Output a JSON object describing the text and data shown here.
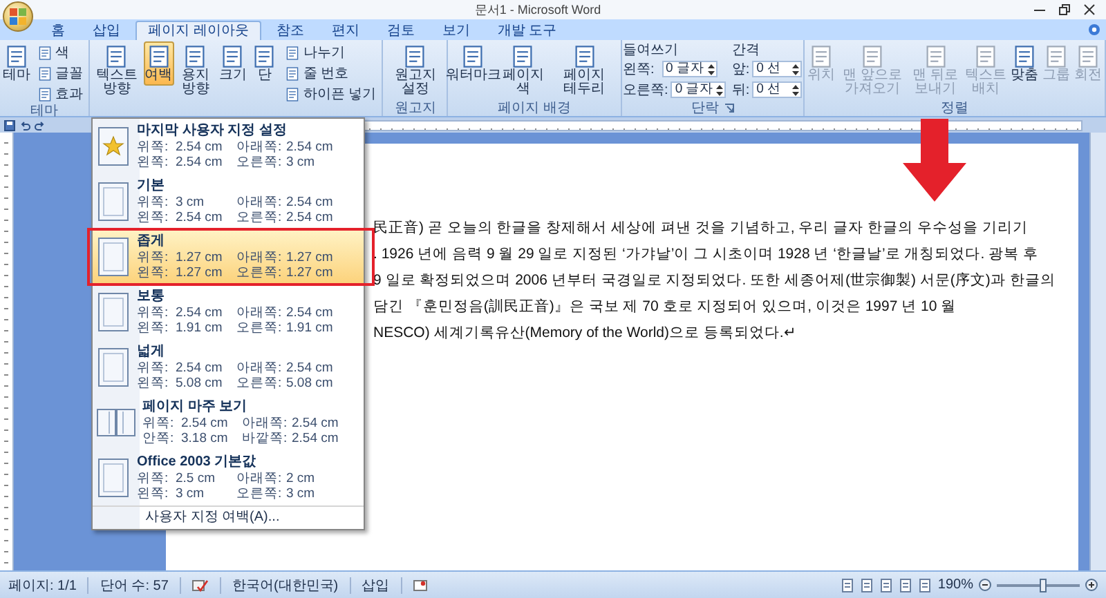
{
  "window": {
    "title": "문서1 - Microsoft Word"
  },
  "tabs": [
    {
      "label": "홈",
      "selected": false
    },
    {
      "label": "삽입",
      "selected": false
    },
    {
      "label": "페이지 레이아웃",
      "selected": true
    },
    {
      "label": "참조",
      "selected": false
    },
    {
      "label": "편지",
      "selected": false
    },
    {
      "label": "검토",
      "selected": false
    },
    {
      "label": "보기",
      "selected": false
    },
    {
      "label": "개발 도구",
      "selected": false
    }
  ],
  "ribbon": {
    "groups": [
      {
        "kind": "buttons",
        "label": "테마",
        "buttons": [
          {
            "label": "테마",
            "kind": "large",
            "pressed": false,
            "disabled": false
          },
          {
            "label": "색",
            "kind": "small",
            "pressed": false,
            "disabled": false
          },
          {
            "label": "글꼴",
            "kind": "small",
            "pressed": false,
            "disabled": false
          },
          {
            "label": "효과",
            "kind": "small",
            "pressed": false,
            "disabled": false
          }
        ]
      },
      {
        "kind": "buttons",
        "buttons": [
          {
            "label": "텍스트 방향",
            "kind": "large",
            "pressed": false,
            "disabled": false
          },
          {
            "label": "여백",
            "kind": "large",
            "pressed": true,
            "disabled": false
          },
          {
            "label": "용지 방향",
            "kind": "large",
            "pressed": false,
            "disabled": false
          },
          {
            "label": "크기",
            "kind": "large",
            "pressed": false,
            "disabled": false
          },
          {
            "label": "단",
            "kind": "large",
            "pressed": false,
            "disabled": false
          },
          {
            "label": "나누기",
            "kind": "small",
            "pressed": false,
            "disabled": false
          },
          {
            "label": "줄 번호",
            "kind": "small",
            "pressed": false,
            "disabled": false
          },
          {
            "label": "하이픈 넣기",
            "kind": "small",
            "pressed": false,
            "disabled": false
          }
        ]
      },
      {
        "kind": "buttons",
        "label": "원고지",
        "buttons": [
          {
            "label": "원고지 설정",
            "kind": "large",
            "pressed": false,
            "disabled": false
          }
        ]
      },
      {
        "kind": "buttons",
        "label": "페이지 배경",
        "buttons": [
          {
            "label": "워터마크",
            "kind": "large",
            "pressed": false,
            "disabled": false
          },
          {
            "label": "페이지 색",
            "kind": "large",
            "pressed": false,
            "disabled": false
          },
          {
            "label": "페이지 테두리",
            "kind": "large",
            "pressed": false,
            "disabled": false
          }
        ]
      },
      {
        "kind": "fields",
        "label": "단락",
        "sections": [
          {
            "title": "들여쓰기",
            "fields": [
              {
                "label": "왼쪽:",
                "value": "0 글자"
              },
              {
                "label": "오른쪽:",
                "value": "0 글자"
              }
            ]
          },
          {
            "title": "간격",
            "fields": [
              {
                "label": "앞:",
                "value": "0 선"
              },
              {
                "label": "뒤:",
                "value": "0 선"
              }
            ]
          }
        ]
      },
      {
        "kind": "buttons",
        "label": "정렬",
        "buttons": [
          {
            "label": "위치",
            "kind": "large",
            "pressed": false,
            "disabled": true
          },
          {
            "label": "맨 앞으로 가져오기",
            "kind": "large",
            "pressed": false,
            "disabled": true
          },
          {
            "label": "맨 뒤로 보내기",
            "kind": "large",
            "pressed": false,
            "disabled": true
          },
          {
            "label": "텍스트 배치",
            "kind": "large",
            "pressed": false,
            "disabled": true
          },
          {
            "label": "맞춤",
            "kind": "large",
            "pressed": false,
            "disabled": false
          },
          {
            "label": "그룹",
            "kind": "large",
            "pressed": false,
            "disabled": true
          },
          {
            "label": "회전",
            "kind": "large",
            "pressed": false,
            "disabled": true
          }
        ]
      }
    ]
  },
  "margin_menu": {
    "items": [
      {
        "title": "마지막 사용자 지정 설정",
        "kind": "custom",
        "selected": false,
        "fields": [
          {
            "label": "위쪽:",
            "value": "2.54 cm"
          },
          {
            "label": "아래쪽:",
            "value": "2.54 cm"
          },
          {
            "label": "왼쪽:",
            "value": "2.54 cm"
          },
          {
            "label": "오른쪽:",
            "value": "3 cm"
          }
        ]
      },
      {
        "title": "기본",
        "kind": "page",
        "selected": false,
        "fields": [
          {
            "label": "위쪽:",
            "value": "3 cm"
          },
          {
            "label": "아래쪽:",
            "value": "2.54 cm"
          },
          {
            "label": "왼쪽:",
            "value": "2.54 cm"
          },
          {
            "label": "오른쪽:",
            "value": "2.54 cm"
          }
        ]
      },
      {
        "title": "좁게",
        "kind": "page",
        "selected": true,
        "fields": [
          {
            "label": "위쪽:",
            "value": "1.27 cm"
          },
          {
            "label": "아래쪽:",
            "value": "1.27 cm"
          },
          {
            "label": "왼쪽:",
            "value": "1.27 cm"
          },
          {
            "label": "오른쪽:",
            "value": "1.27 cm"
          }
        ]
      },
      {
        "title": "보통",
        "kind": "page",
        "selected": false,
        "fields": [
          {
            "label": "위쪽:",
            "value": "2.54 cm"
          },
          {
            "label": "아래쪽:",
            "value": "2.54 cm"
          },
          {
            "label": "왼쪽:",
            "value": "1.91 cm"
          },
          {
            "label": "오른쪽:",
            "value": "1.91 cm"
          }
        ]
      },
      {
        "title": "넓게",
        "kind": "page",
        "selected": false,
        "fields": [
          {
            "label": "위쪽:",
            "value": "2.54 cm"
          },
          {
            "label": "아래쪽:",
            "value": "2.54 cm"
          },
          {
            "label": "왼쪽:",
            "value": "5.08 cm"
          },
          {
            "label": "오른쪽:",
            "value": "5.08 cm"
          }
        ]
      },
      {
        "title": "페이지 마주 보기",
        "kind": "mirrored",
        "selected": false,
        "fields": [
          {
            "label": "위쪽:",
            "value": "2.54 cm"
          },
          {
            "label": "아래쪽:",
            "value": "2.54 cm"
          },
          {
            "label": "안쪽:",
            "value": "3.18 cm"
          },
          {
            "label": "바깥쪽:",
            "value": "2.54 cm"
          }
        ]
      },
      {
        "title": "Office 2003 기본값",
        "kind": "page",
        "selected": false,
        "fields": [
          {
            "label": "위쪽:",
            "value": "2.5 cm"
          },
          {
            "label": "아래쪽:",
            "value": "2 cm"
          },
          {
            "label": "왼쪽:",
            "value": "3 cm"
          },
          {
            "label": "오른쪽:",
            "value": "3 cm"
          }
        ]
      }
    ],
    "footer": "사용자 지정 여백(A)..."
  },
  "document": {
    "lines": [
      "民正音) 곧 오늘의 한글을 창제해서 세상에 펴낸 것을 기념하고, 우리 글자 한글의 우수성을 기리기",
      ". 1926 년에 음력 9 월 29 일로 지정된 ‘가갸날’이 그 시초이며 1928 년 ‘한글날’로 개칭되었다. 광복 후",
      "9 일로 확정되었으며 2006 년부터 국경일로 지정되었다. 또한 세종어제(世宗御製) 서문(序文)과 한글의",
      "담긴 『훈민정음(訓民正音)』은 국보 제 70 호로 지정되어 있으며, 이것은 1997 년 10 월",
      "NESCO) 세계기록유산(Memory of the World)으로 등록되었다.↵"
    ]
  },
  "status_bar": {
    "page": "페이지: 1/1",
    "words": "단어 수: 57",
    "language": "한국어(대한민국)",
    "mode": "삽입",
    "zoom": "190%",
    "zoom_slider": {
      "level": 0.55
    }
  }
}
